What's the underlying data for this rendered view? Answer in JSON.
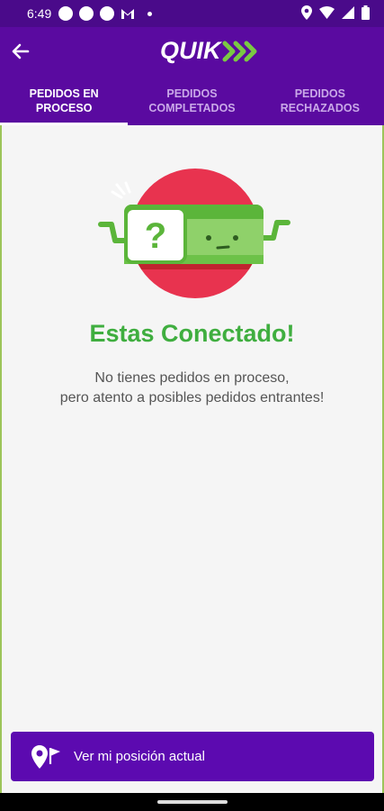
{
  "status_bar": {
    "time": "6:49"
  },
  "app_bar": {
    "logo_text": "QUIK",
    "brand_colors": {
      "primary": "#5a0aa0",
      "accent": "#7ac943"
    }
  },
  "tabs": [
    {
      "label": "PEDIDOS EN\nPROCESO",
      "active": true
    },
    {
      "label": "PEDIDOS\nCOMPLETADOS",
      "active": false
    },
    {
      "label": "PEDIDOS\nRECHAZADOS",
      "active": false
    }
  ],
  "empty_state": {
    "title": "Estas Conectado!",
    "subtitle_line1": "No tienes pedidos en proceso,",
    "subtitle_line2": "pero atento a posibles pedidos entrantes!"
  },
  "location_button": {
    "label": "Ver mi posición actual",
    "icon": "location-flag-icon"
  }
}
